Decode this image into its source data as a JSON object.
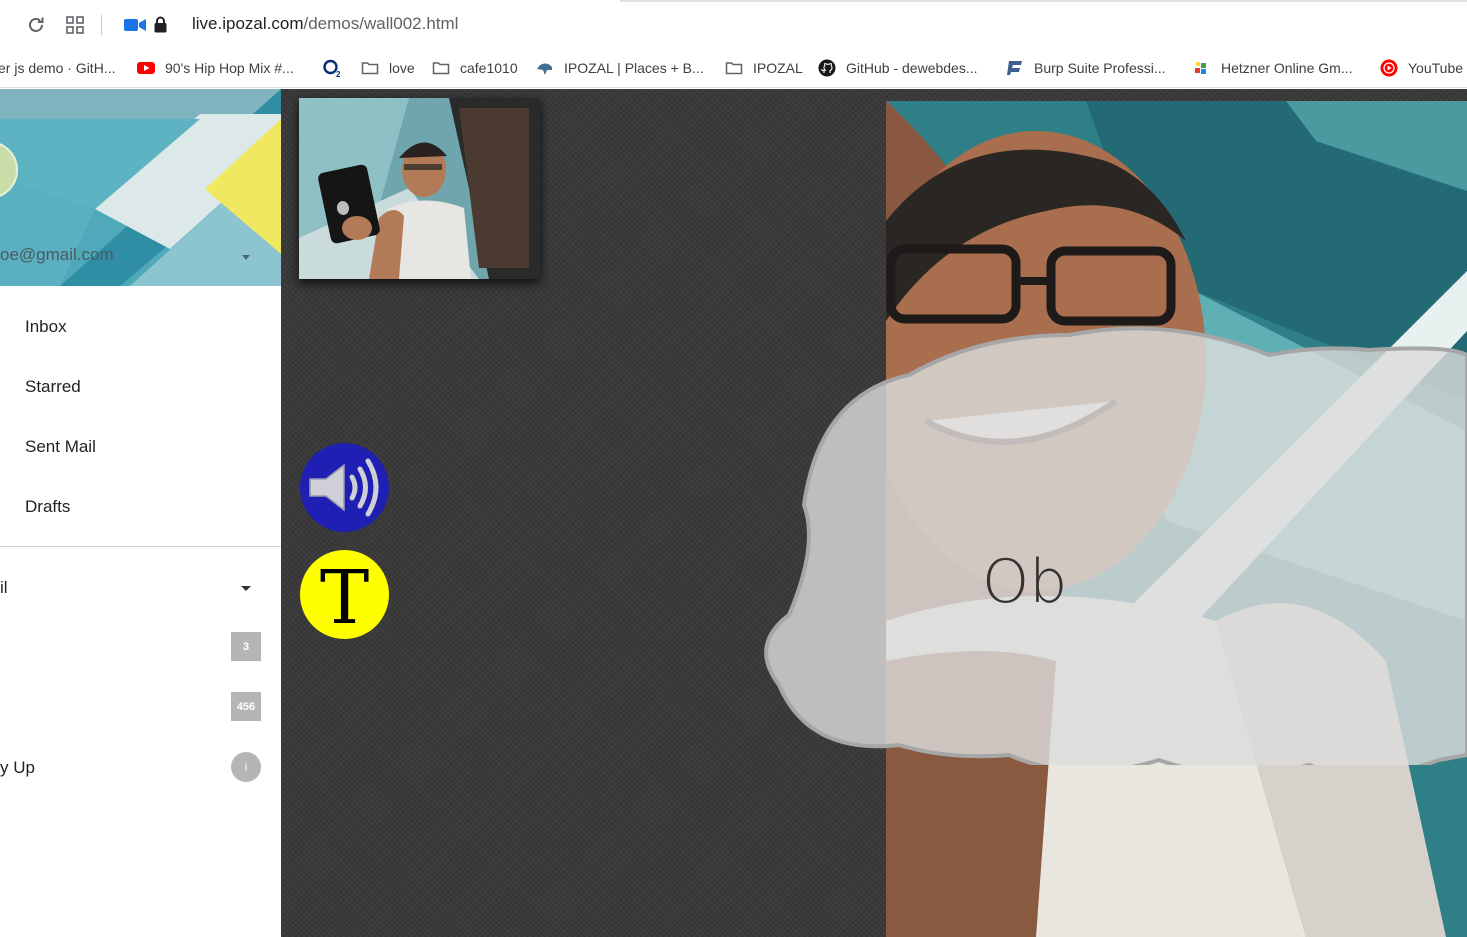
{
  "browser": {
    "url_host": "live.ipozal.com",
    "url_path": "/demos/wall002.html"
  },
  "bookmarks": [
    {
      "label": "er js demo · GitH...",
      "icon": "github-icon"
    },
    {
      "label": "90's Hip Hop Mix #...",
      "icon": "youtube-icon"
    },
    {
      "label": "",
      "icon": "o2-icon"
    },
    {
      "label": "love",
      "icon": "folder-icon"
    },
    {
      "label": "cafe1010",
      "icon": "folder-icon"
    },
    {
      "label": "IPOZAL | Places + B...",
      "icon": "ipozal-icon"
    },
    {
      "label": "IPOZAL",
      "icon": "folder-icon"
    },
    {
      "label": "GitHub - dewebdes...",
      "icon": "github-icon"
    },
    {
      "label": "Burp Suite Professi...",
      "icon": "burp-icon"
    },
    {
      "label": "Hetzner Online Gm...",
      "icon": "hetzner-icon"
    },
    {
      "label": "YouTube",
      "icon": "youtube-music-icon"
    }
  ],
  "sidebar": {
    "email": "oe@gmail.com",
    "nav": [
      "Inbox",
      "Starred",
      "Sent Mail",
      "Drafts"
    ],
    "section_label": "il",
    "badges": [
      "3",
      "456"
    ],
    "follow_label": "y Up",
    "info_badge": "i"
  },
  "stage": {
    "bubble_text": "Ob",
    "text_button_label": "T"
  },
  "colors": {
    "speaker_button": "#1f1fb4",
    "text_button": "#ffff00",
    "stage_background": "#3a3a3a"
  }
}
